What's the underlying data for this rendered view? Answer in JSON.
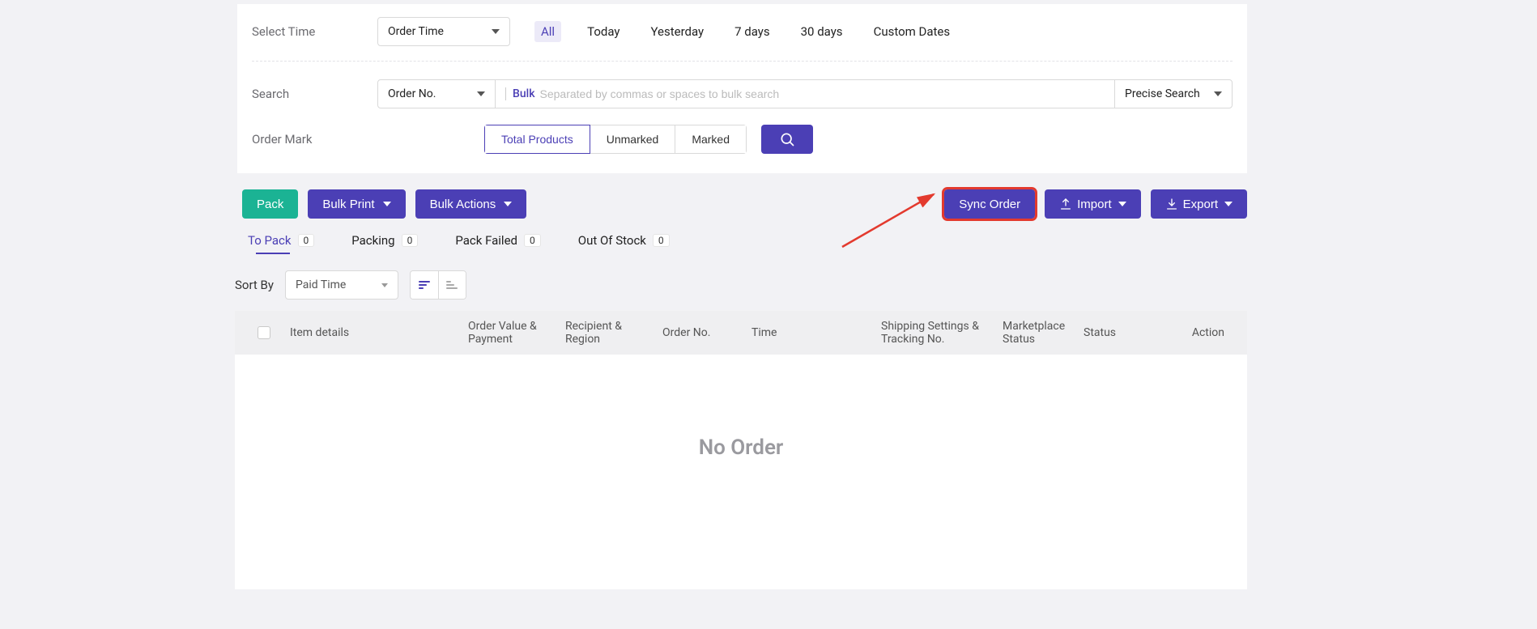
{
  "filters": {
    "time_label": "Select Time",
    "time_select": "Order Time",
    "time_options": [
      "All",
      "Today",
      "Yesterday",
      "7 days",
      "30 days",
      "Custom Dates"
    ],
    "time_active": "All",
    "search_label": "Search",
    "search_field_select": "Order No.",
    "bulk_tag": "Bulk",
    "search_placeholder": "Separated by commas or spaces to bulk search",
    "precise_select": "Precise Search",
    "ordermark_label": "Order Mark",
    "mark_options": [
      "Total Products",
      "Unmarked",
      "Marked"
    ],
    "mark_active": "Total Products"
  },
  "toolbar": {
    "pack": "Pack",
    "bulk_print": "Bulk Print",
    "bulk_actions": "Bulk Actions",
    "sync_order": "Sync Order",
    "import": "Import",
    "export": "Export"
  },
  "tabs": {
    "items": [
      {
        "label": "To Pack",
        "count": "0",
        "active": true
      },
      {
        "label": "Packing",
        "count": "0"
      },
      {
        "label": "Pack Failed",
        "count": "0"
      },
      {
        "label": "Out Of Stock",
        "count": "0"
      }
    ]
  },
  "sort": {
    "label": "Sort By",
    "value": "Paid Time"
  },
  "table": {
    "headers": {
      "item": "Item details",
      "order_value": "Order Value & Payment",
      "recipient": "Recipient & Region",
      "order_no": "Order No.",
      "time": "Time",
      "shipping": "Shipping Settings & Tracking No.",
      "marketplace": "Marketplace Status",
      "status": "Status",
      "action": "Action"
    },
    "empty_text": "No Order"
  }
}
